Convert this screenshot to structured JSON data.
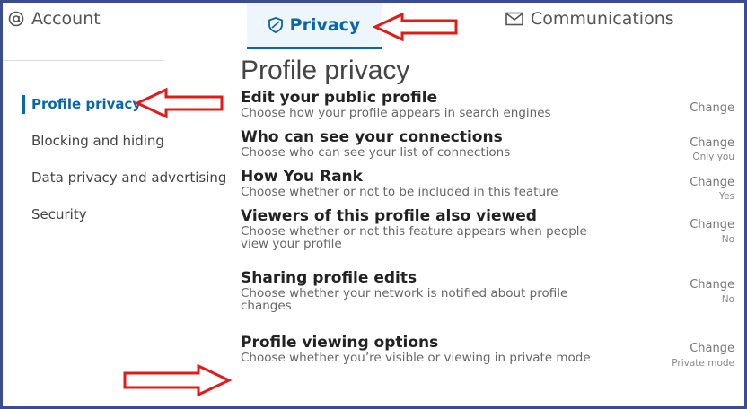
{
  "tabs": [
    {
      "label": "Account",
      "icon": "at-sign-icon"
    },
    {
      "label": "Privacy",
      "icon": "shield-icon",
      "active": true
    },
    {
      "label": "Communications",
      "icon": "envelope-icon"
    }
  ],
  "sidebar": {
    "items": [
      {
        "label": "Profile privacy",
        "active": true
      },
      {
        "label": "Blocking and hiding"
      },
      {
        "label": "Data privacy and advertising"
      },
      {
        "label": "Security"
      }
    ]
  },
  "main": {
    "title": "Profile privacy",
    "settings": [
      {
        "title": "Edit your public profile",
        "desc": "Choose how your profile appears in search engines",
        "action": "Change",
        "value": ""
      },
      {
        "title": "Who can see your connections",
        "desc": "Choose who can see your list of connections",
        "action": "Change",
        "value": "Only you"
      },
      {
        "title": "How You Rank",
        "desc": "Choose whether or not to be included in this feature",
        "action": "Change",
        "value": "Yes"
      },
      {
        "title": "Viewers of this profile also viewed",
        "desc": "Choose whether or not this feature appears when people view your profile",
        "action": "Change",
        "value": "No"
      },
      {
        "title": "Sharing profile edits",
        "desc": "Choose whether your network is notified about profile changes",
        "action": "Change",
        "value": "No"
      },
      {
        "title": "Profile viewing options",
        "desc": "Choose whether you’re visible or viewing in private mode",
        "action": "Change",
        "value": "Private mode"
      }
    ]
  },
  "colors": {
    "accent": "#0a66a8",
    "frame": "#3b4d8f",
    "annotation_arrow": "#e01b1b"
  }
}
